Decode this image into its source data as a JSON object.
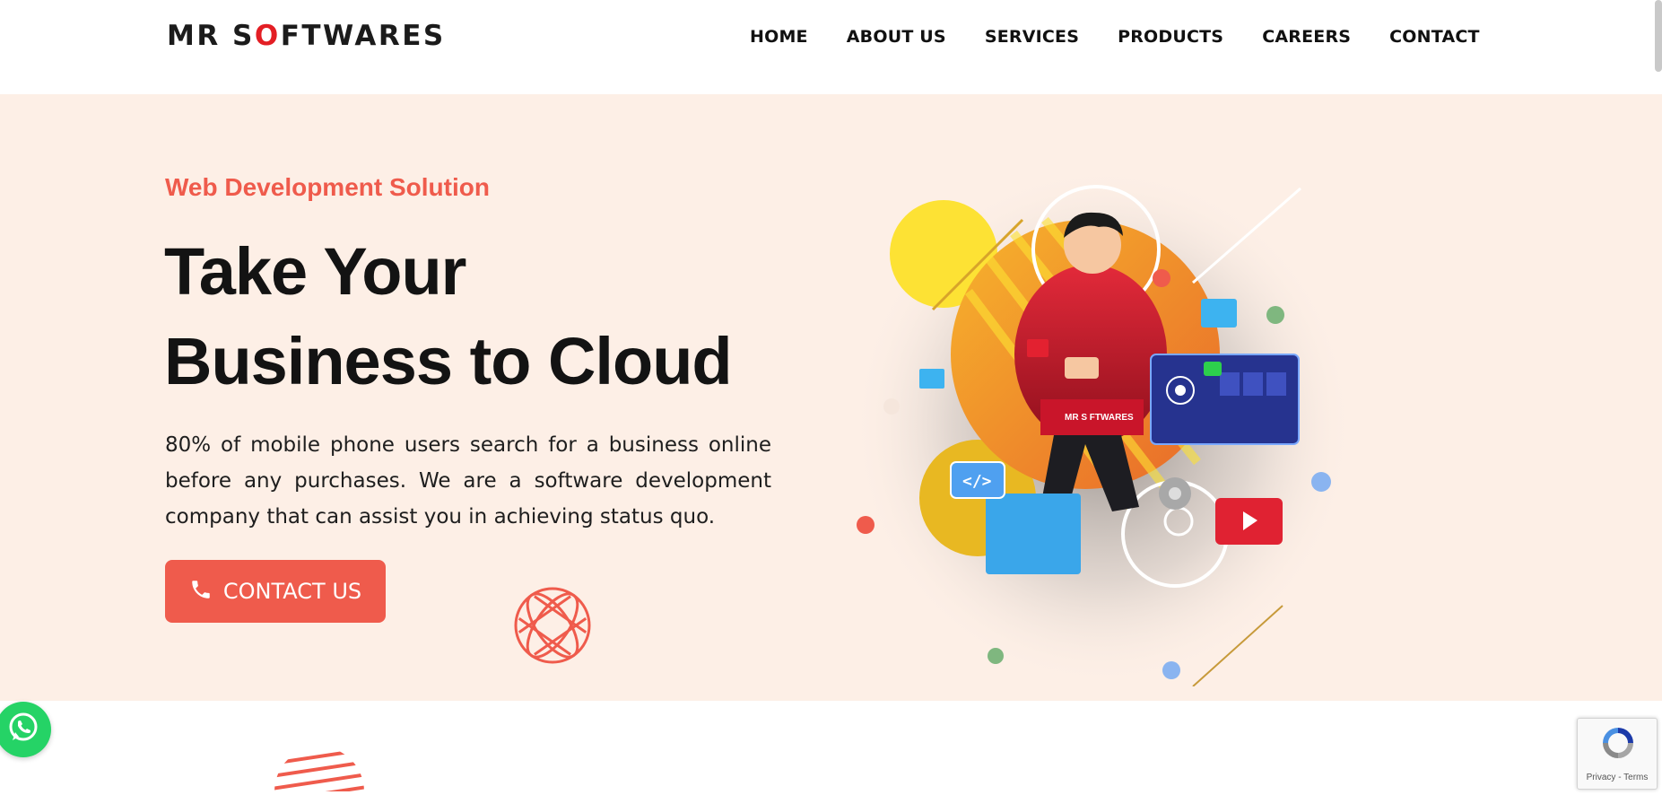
{
  "header": {
    "logo": {
      "part1": "MR S",
      "part2": "O",
      "part3": "FTWARES"
    },
    "nav": [
      "HOME",
      "ABOUT US",
      "SERVICES",
      "PRODUCTS",
      "CAREERS",
      "CONTACT"
    ]
  },
  "hero": {
    "kicker": "Web Development Solution",
    "headline_line1": "Take Your",
    "headline_line2": "Business to Cloud",
    "description": "80% of mobile phone users search for a business online before any purchases. We are a software development company that can assist you in achieving status quo.",
    "cta_label": "CONTACT US",
    "illustration_shirt_text": "MR S  FTWARES"
  },
  "recaptcha": {
    "links": "Privacy - Terms"
  },
  "colors": {
    "accent": "#ef5b4c",
    "hero_bg": "#fdefe6",
    "logo_red": "#e31e24",
    "whatsapp": "#25d366"
  },
  "icons": [
    "phone-icon",
    "globe-icon",
    "whatsapp-icon",
    "recaptcha-icon"
  ]
}
